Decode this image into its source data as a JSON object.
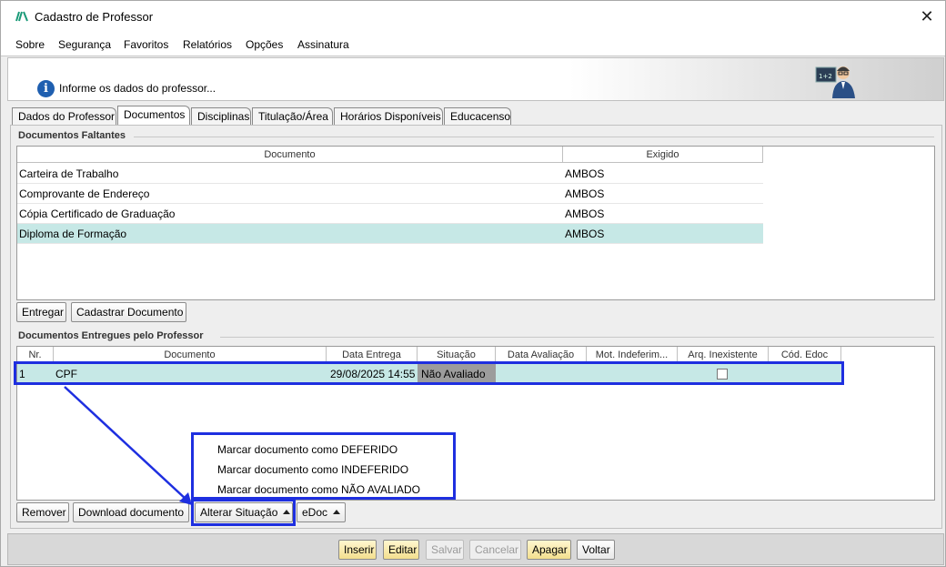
{
  "window": {
    "title": "Cadastro de Professor",
    "close_glyph": "✕"
  },
  "menu": [
    {
      "label": "Sobre",
      "accel": "o"
    },
    {
      "label": "Segurança"
    },
    {
      "label": "Favoritos"
    },
    {
      "label": "Relatórios",
      "accel": "R"
    },
    {
      "label": "Opções",
      "accel": "O"
    },
    {
      "label": "Assinatura",
      "accel": "A"
    }
  ],
  "header": {
    "info_text": "Informe os dados do professor...",
    "info_glyph": "i"
  },
  "tabs": [
    {
      "label": "Dados do Professor"
    },
    {
      "label": "Documentos",
      "active": true
    },
    {
      "label": "Disciplinas"
    },
    {
      "label": "Titulação/Área"
    },
    {
      "label": "Horários Disponíveis"
    },
    {
      "label": "Educacenso"
    }
  ],
  "faltantes": {
    "section_title": "Documentos Faltantes",
    "columns": [
      "Documento",
      "Exigido"
    ],
    "rows": [
      {
        "documento": "Carteira de Trabalho",
        "exigido": "AMBOS"
      },
      {
        "documento": "Comprovante de Endereço",
        "exigido": "AMBOS"
      },
      {
        "documento": "Cópia Certificado de Graduação",
        "exigido": "AMBOS"
      },
      {
        "documento": "Diploma de Formação",
        "exigido": "AMBOS",
        "selected": true
      }
    ],
    "buttons": {
      "entregar": "Entregar",
      "cadastrar": "Cadastrar Documento"
    }
  },
  "entregues": {
    "section_title": "Documentos Entregues pelo Professor",
    "columns": [
      "Nr.",
      "Documento",
      "Data Entrega",
      "Situação",
      "Data Avaliação",
      "Mot. Indeferim...",
      "Arq. Inexistente",
      "Cód. Edoc"
    ],
    "rows": [
      {
        "nr": "1",
        "documento": "CPF",
        "data_entrega": "29/08/2025 14:55",
        "situacao": "Não Avaliado",
        "data_avaliacao": "",
        "mot": "",
        "arq_inexistente": false,
        "cod_edoc": ""
      }
    ],
    "buttons": {
      "remover": "Remover",
      "download": "Download documento",
      "alterar": "Alterar Situação",
      "edoc": "eDoc"
    }
  },
  "popup_menu": [
    "Marcar documento como DEFERIDO",
    "Marcar documento como INDEFERIDO",
    "Marcar documento como NÃO AVALIADO"
  ],
  "footer_buttons": [
    {
      "label": "Inserir",
      "accel": "I",
      "enabled": true
    },
    {
      "label": "Editar",
      "accel": "E",
      "enabled": true
    },
    {
      "label": "Salvar",
      "accel": "S",
      "enabled": false
    },
    {
      "label": "Cancelar",
      "accel": "C",
      "enabled": false
    },
    {
      "label": "Apagar",
      "accel": "A",
      "enabled": true
    },
    {
      "label": "Voltar",
      "accel": "V",
      "enabled": true
    }
  ],
  "colors": {
    "selection_row": "#c6e8e6",
    "status_cell": "#9c9c9c",
    "annotation_blue": "#1e2fe0",
    "accent_yellow": "#f3df8e"
  }
}
